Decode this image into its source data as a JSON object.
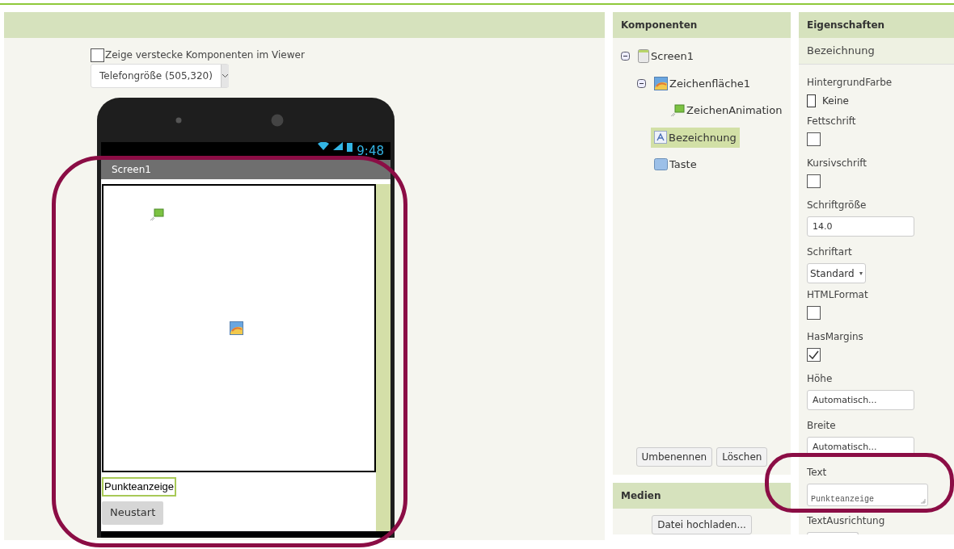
{
  "viewer": {
    "hidden_toggle": {
      "label": "Zeige verstecke Komponenten im Viewer",
      "checked": false
    },
    "size_dropdown": {
      "value": "Telefongröße (505,320)"
    },
    "phone": {
      "time": "9:48",
      "screen_title": "Screen1",
      "components": [
        {
          "kind": "canvas"
        },
        {
          "kind": "label",
          "text": "Punkteanzeige",
          "selected": true
        },
        {
          "kind": "button",
          "text": "Neustart"
        }
      ]
    }
  },
  "components": {
    "title": "Komponenten",
    "tree": [
      {
        "label": "Screen1",
        "kind": "screen",
        "expanded": true,
        "selected": false,
        "children": [
          {
            "label": "Zeichenfläche1",
            "kind": "canvas",
            "expanded": true,
            "selected": false,
            "children": [
              {
                "label": "ZeichenAnimation",
                "kind": "sprite",
                "selected": false
              }
            ]
          },
          {
            "label": "Bezeichnung",
            "kind": "label",
            "selected": true
          },
          {
            "label": "Taste",
            "kind": "button",
            "selected": false
          }
        ]
      }
    ],
    "buttons": [
      "Umbenennen",
      "Löschen"
    ]
  },
  "media": {
    "title": "Medien",
    "upload_button": "Datei hochladen..."
  },
  "properties": {
    "title": "Eigenschaften",
    "component": "Bezeichnung",
    "items": [
      {
        "kind": "color",
        "label": "HintergrundFarbe",
        "value": "Keine"
      },
      {
        "kind": "checkbox",
        "label": "Fettschrift",
        "checked": false
      },
      {
        "kind": "checkbox",
        "label": "Kursivschrift",
        "checked": false
      },
      {
        "kind": "text",
        "label": "Schriftgröße",
        "value": "14.0"
      },
      {
        "kind": "dropdown",
        "label": "Schriftart",
        "value": "Standard"
      },
      {
        "kind": "checkbox",
        "label": "HTMLFormat",
        "checked": false
      },
      {
        "kind": "checkbox",
        "label": "HasMargins",
        "checked": true
      },
      {
        "kind": "text",
        "label": "Höhe",
        "value": "Automatisch..."
      },
      {
        "kind": "text",
        "label": "Breite",
        "value": "Automatisch..."
      },
      {
        "kind": "textarea",
        "label": "Text",
        "value": "Punkteanzeige"
      },
      {
        "kind": "cutoff",
        "label": "TextAusrichtung"
      }
    ]
  }
}
